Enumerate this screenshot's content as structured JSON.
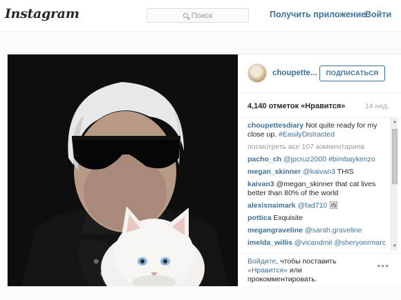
{
  "header": {
    "logo": "Instagram",
    "search_placeholder": "Поиск",
    "get_app": "Получить приложение",
    "login": "Войти"
  },
  "post": {
    "username": "choupette...",
    "follow_label": "ПОДПИСАТЬСЯ",
    "likes": "4,140 отметок «Нравится»",
    "age": "14 нед.",
    "caption": {
      "user": "choupettesdiary",
      "text": "Not quite ready for my close up.",
      "tag": "#EasilyDistracted"
    },
    "view_all": "посмотреть все 107 комментариев",
    "comments": [
      {
        "user": "pacho_ch",
        "mention": "@jpcruz2000 #bimbaykenzo",
        "text": ""
      },
      {
        "user": "megan_skinner",
        "mention": "@kaivan3",
        "text": "THIS"
      },
      {
        "user": "kaivan3",
        "mention": "",
        "text": "@megan_skinner that cat lives better than 80% of the world"
      },
      {
        "user": "alexisnaimark",
        "mention": "@fad710",
        "text": "🖼"
      },
      {
        "user": "pottica",
        "mention": "",
        "text": "Exquisite"
      },
      {
        "user": "megangraveline",
        "mention": "@sarah.graveline",
        "text": ""
      },
      {
        "user": "imelda_willis",
        "mention": "@vicandmil @sheryonrmarc",
        "text": ""
      }
    ],
    "login_prompt": {
      "link1": "Войдите",
      "mid": ", чтобы поставить",
      "link2": "«Нравится»",
      "mid2": " или",
      "end": "прокомментировать."
    },
    "more_icon": "ellipsis-icon"
  }
}
